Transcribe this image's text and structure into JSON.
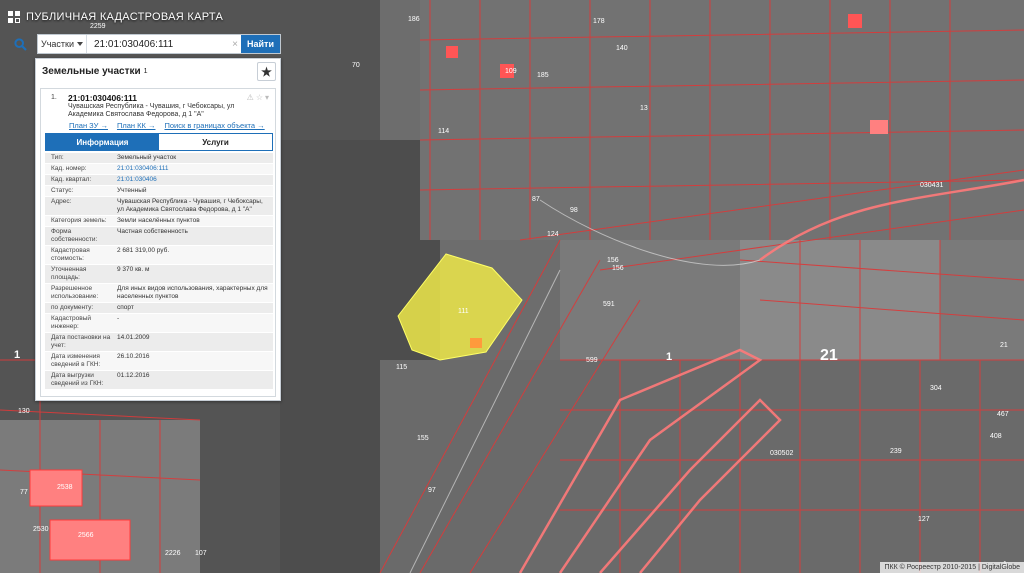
{
  "app": {
    "title": "ПУБЛИЧНАЯ КАДАСТРОВАЯ КАРТА"
  },
  "search": {
    "type_selected": "Участки",
    "query": "21:01:030406:111",
    "button": "Найти"
  },
  "panel": {
    "title": "Земельные участки",
    "count": "1",
    "card": {
      "index": "1.",
      "cadastral_number": "21:01:030406:111",
      "address": "Чувашская Республика - Чувашия, г Чебоксары, ул Академика Святослава Федорова, д 1 \"А\"",
      "links": [
        "План ЗУ →",
        "План КК →",
        "Поиск в границах объекта →"
      ],
      "tabs": [
        "Информация",
        "Услуги"
      ],
      "rows": [
        {
          "k": "Тип:",
          "v": "Земельный участок"
        },
        {
          "k": "Кад. номер:",
          "v": "21:01:030406:111",
          "link": true
        },
        {
          "k": "Кад. квартал:",
          "v": "21:01:030406",
          "link": true
        },
        {
          "k": "Статус:",
          "v": "Учтенный"
        },
        {
          "k": "Адрес:",
          "v": "Чувашская Республика - Чувашия, г Чебоксары, ул Академика Святослава Федорова, д 1 \"А\""
        },
        {
          "k": "Категория земель:",
          "v": "Земли населённых пунктов"
        },
        {
          "k": "Форма собственности:",
          "v": "Частная собственность"
        },
        {
          "k": "Кадастровая стоимость:",
          "v": "2 681 319,00 руб."
        },
        {
          "k": "Уточненная площадь:",
          "v": "9 370 кв. м"
        },
        {
          "k": "Разрешенное использование:",
          "v": "Для иных видов использования, характерных для населенных пунктов"
        },
        {
          "k": "по документу:",
          "v": "спорт"
        },
        {
          "k": "Кадастровый инженер:",
          "v": "-"
        },
        {
          "k": "Дата постановки на учет:",
          "v": "14.01.2009"
        },
        {
          "k": "Дата изменения сведений в ГКН:",
          "v": "26.10.2016"
        },
        {
          "k": "Дата выгрузки сведений из ГКН:",
          "v": "01.12.2016"
        }
      ]
    }
  },
  "map": {
    "parcel_label": "111",
    "district_label_1": "1",
    "district_label_2": "1",
    "district_label_21": "21",
    "quarter_label_1": "030431",
    "quarter_label_2": "030502",
    "parcel_numbers": [
      "186",
      "70",
      "109",
      "156",
      "178",
      "140",
      "185",
      "114",
      "13",
      "98",
      "87",
      "124",
      "156",
      "599",
      "591",
      "21",
      "304",
      "467",
      "408",
      "2538",
      "2566",
      "2226",
      "107",
      "2530",
      "77",
      "130",
      "115",
      "155",
      "97",
      "239",
      "127",
      "2259",
      "1"
    ]
  },
  "footer": {
    "copyright": "ПКК © Росреестр 2010-2015 | DigitalGlobe"
  },
  "colors": {
    "accent": "#1e6fb8",
    "parcel_highlight": "#e6e04a",
    "boundary": "#e23a3a"
  }
}
